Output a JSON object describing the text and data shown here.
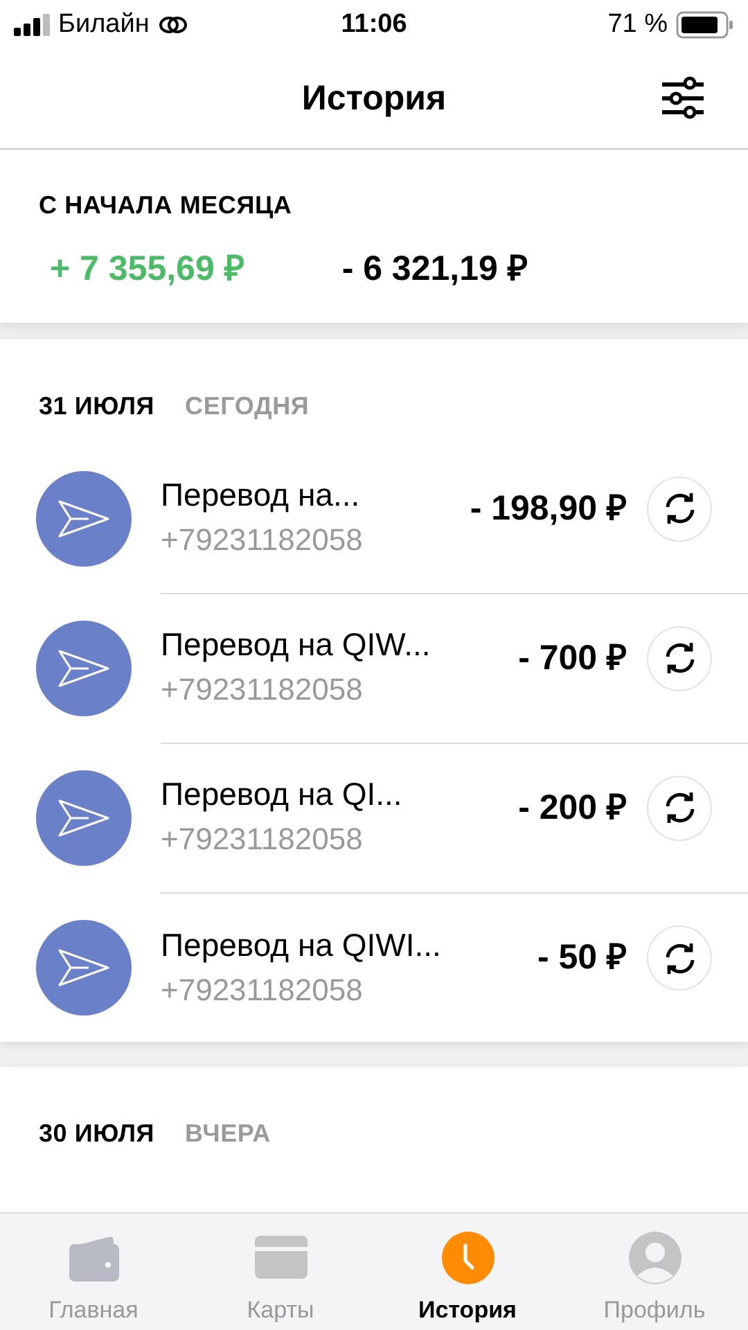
{
  "status_bar": {
    "carrier": "Билайн",
    "time": "11:06",
    "battery": "71 %"
  },
  "header": {
    "title": "История"
  },
  "summary": {
    "label": "С НАЧАЛА МЕСЯЦА",
    "income": "+ 7 355,69 ₽",
    "expense": "- 6 321,19 ₽"
  },
  "days": [
    {
      "date": "31 ИЮЛЯ",
      "relative": "СЕГОДНЯ",
      "transactions": [
        {
          "title": "Перевод на...",
          "subtitle": "+79231182058",
          "amount": "- 198,90 ₽"
        },
        {
          "title": "Перевод на QIW...",
          "subtitle": "+79231182058",
          "amount": "- 700 ₽"
        },
        {
          "title": "Перевод на QI...",
          "subtitle": "+79231182058",
          "amount": "- 200 ₽"
        },
        {
          "title": "Перевод на QIWI...",
          "subtitle": "+79231182058",
          "amount": "- 50 ₽"
        }
      ]
    },
    {
      "date": "30 ИЮЛЯ",
      "relative": "ВЧЕРА"
    }
  ],
  "tab_bar": [
    {
      "label": "Главная",
      "kind": "wallet",
      "selected": false
    },
    {
      "label": "Карты",
      "kind": "card",
      "selected": false
    },
    {
      "label": "История",
      "kind": "clock",
      "selected": true
    },
    {
      "label": "Профиль",
      "kind": "profile",
      "selected": false
    }
  ]
}
